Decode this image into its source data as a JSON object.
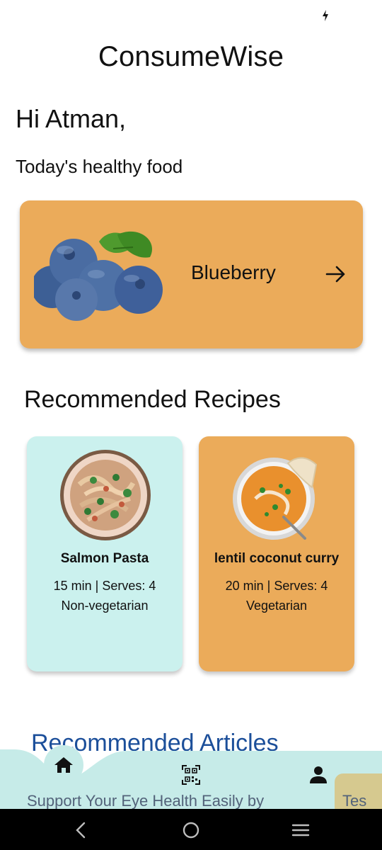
{
  "status": {
    "charging_icon": "bolt-icon"
  },
  "app": {
    "title": "ConsumeWise"
  },
  "greeting": "Hi Atman,",
  "healthy_food": {
    "section_title": "Today's healthy food",
    "item_name": "Blueberry",
    "image_icon": "blueberry-image",
    "arrow_icon": "arrow-right-icon",
    "card_color": "#ebab5a"
  },
  "recipes": {
    "section_title": "Recommended Recipes",
    "items": [
      {
        "name": "Salmon Pasta",
        "meta": "15 min | Serves: 4",
        "type": "Non-vegetarian",
        "color": "#cbf1ee"
      },
      {
        "name": "lentil coconut curry",
        "meta": "20 min | Serves: 4",
        "type": "Vegetarian",
        "color": "#ebab5a"
      }
    ]
  },
  "articles": {
    "section_title": "Recommended Articles",
    "items": [
      {
        "title": "Support Your Eye Health Easily by"
      },
      {
        "title": "Tes"
      }
    ],
    "title_color": "#1c4f9a"
  },
  "bottom_nav": {
    "items": [
      {
        "icon": "home-icon",
        "active": true
      },
      {
        "icon": "qr-scan-icon",
        "active": false
      },
      {
        "icon": "profile-icon",
        "active": false
      }
    ],
    "accent": "#c6ebe8"
  },
  "system_nav": {
    "back_icon": "back-icon",
    "home_icon": "home-circle-icon",
    "recents_icon": "recents-icon"
  }
}
